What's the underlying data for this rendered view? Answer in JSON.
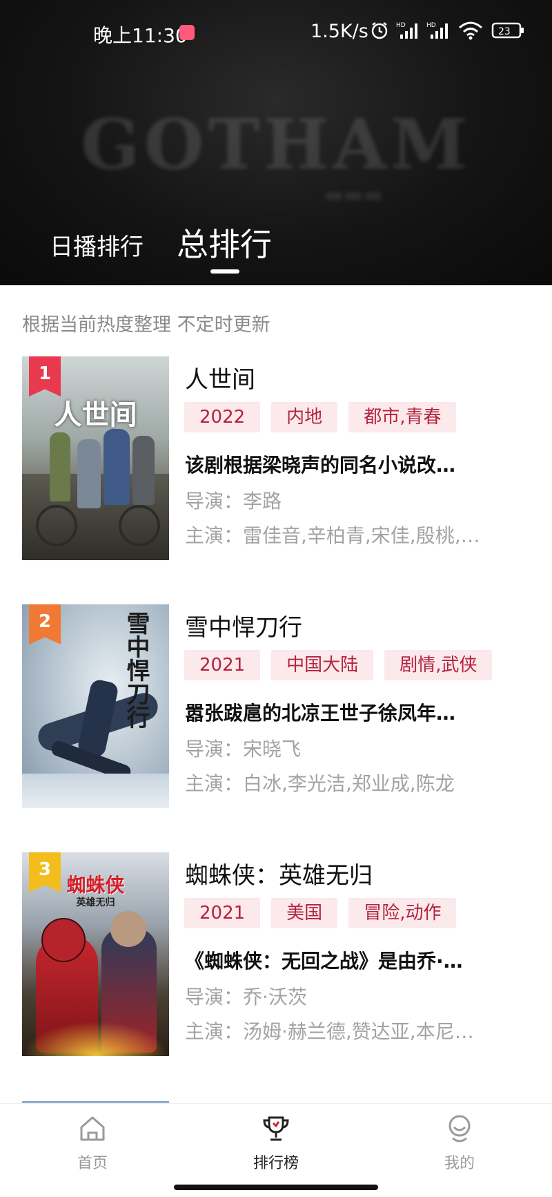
{
  "status_bar": {
    "time": "晚上11:30",
    "net_speed": "1.5K/s",
    "battery": "23"
  },
  "hero": {
    "backdrop_text": "GOTHAM"
  },
  "tabs": [
    {
      "label": "日播排行",
      "active": false
    },
    {
      "label": "总排行",
      "active": true
    }
  ],
  "subtitle": "根据当前热度整理 不定时更新",
  "items": [
    {
      "rank": "1",
      "badge_color": "#e8394e",
      "poster_text": "人世间",
      "title": "人世间",
      "tags": [
        "2022",
        "内地",
        "都市,青春"
      ],
      "desc": "该剧根据梁晓声的同名小说改…",
      "director": "导演：李路",
      "cast": "主演：雷佳音,辛柏青,宋佳,殷桃,…"
    },
    {
      "rank": "2",
      "badge_color": "#f07a33",
      "poster_text": "雪中悍刀行",
      "title": "雪中悍刀行",
      "tags": [
        "2021",
        "中国大陆",
        "剧情,武侠"
      ],
      "desc": "嚣张跋扈的北凉王世子徐凤年…",
      "director": "导演：宋晓飞",
      "cast": "主演：白冰,李光洁,郑业成,陈龙"
    },
    {
      "rank": "3",
      "badge_color": "#f2bd1d",
      "poster_text": "蜘蛛侠",
      "poster_subtext": "英雄无归",
      "title": "蜘蛛侠：英雄无归",
      "tags": [
        "2021",
        "美国",
        "冒险,动作"
      ],
      "desc": "《蜘蛛侠：无回之战》是由乔·…",
      "director": "导演：乔·沃茨",
      "cast": "主演：汤姆·赫兰德,赞达亚,本尼…"
    }
  ],
  "bottom_nav": [
    {
      "label": "首页",
      "icon": "home-icon",
      "active": false
    },
    {
      "label": "排行榜",
      "icon": "trophy-icon",
      "active": true
    },
    {
      "label": "我的",
      "icon": "profile-icon",
      "active": false
    }
  ],
  "colors": {
    "accent": "#b3233f",
    "tag_bg": "#fbe9ec",
    "muted_text": "#a3a3a3"
  }
}
